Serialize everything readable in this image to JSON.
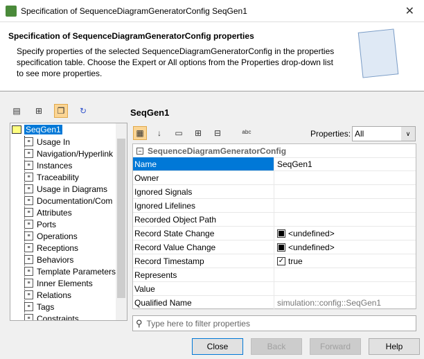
{
  "window": {
    "title": "Specification of SequenceDiagramGeneratorConfig SeqGen1"
  },
  "header": {
    "title": "Specification of SequenceDiagramGeneratorConfig properties",
    "description": "Specify properties of the selected SequenceDiagramGeneratorConfig in the properties specification table. Choose the Expert or All options from the Properties drop-down list to see more properties."
  },
  "tree": {
    "root": "SeqGen1",
    "items": [
      "Usage In",
      "Navigation/Hyperlink",
      "Instances",
      "Traceability",
      "Usage in Diagrams",
      "Documentation/Com",
      "Attributes",
      "Ports",
      "Operations",
      "Receptions",
      "Behaviors",
      "Template Parameters",
      "Inner Elements",
      "Relations",
      "Tags",
      "Constraints"
    ]
  },
  "main": {
    "title": "SeqGen1",
    "properties_label": "Properties:",
    "properties_value": "All",
    "group": "SequenceDiagramGeneratorConfig",
    "rows": [
      {
        "k": "Name",
        "v": "SeqGen1"
      },
      {
        "k": "Owner",
        "v": ""
      },
      {
        "k": "Ignored Signals",
        "v": ""
      },
      {
        "k": "Ignored Lifelines",
        "v": ""
      },
      {
        "k": "Recorded Object Path",
        "v": ""
      },
      {
        "k": "Record State Change",
        "v": "<undefined>"
      },
      {
        "k": "Record Value Change",
        "v": "<undefined>"
      },
      {
        "k": "Record Timestamp",
        "v": "true"
      },
      {
        "k": "Represents",
        "v": ""
      },
      {
        "k": "Value",
        "v": ""
      },
      {
        "k": "Qualified Name",
        "v": "simulation::config::SeqGen1"
      }
    ],
    "filter_placeholder": "Type here to filter properties"
  },
  "buttons": {
    "close": "Close",
    "back": "Back",
    "forward": "Forward",
    "help": "Help"
  }
}
